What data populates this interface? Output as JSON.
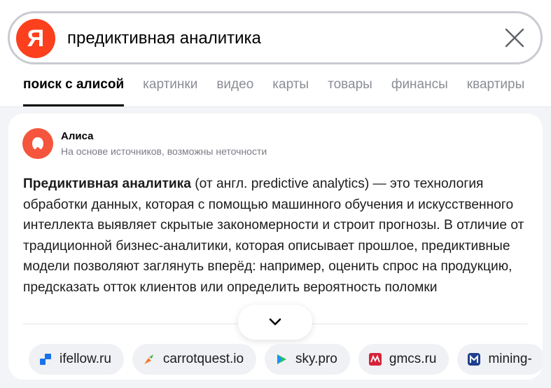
{
  "search": {
    "query": "предиктивная аналитика",
    "logo_letter": "Я"
  },
  "tabs": [
    {
      "label": "поиск с алисой",
      "active": true
    },
    {
      "label": "картинки"
    },
    {
      "label": "видео"
    },
    {
      "label": "карты"
    },
    {
      "label": "товары"
    },
    {
      "label": "финансы"
    },
    {
      "label": "квартиры"
    }
  ],
  "alice": {
    "name": "Алиса",
    "subtitle": "На основе источников, возможны неточности",
    "answer_bold": "Предиктивная аналитика",
    "answer_text": " (от англ. predictive analytics) — это технология обработки данных, которая с помощью машинного обучения и искусственного интеллекта выявляет скрытые закономерности и строит прогнозы. В отличие от традиционной бизнес-аналитики, которая описывает прошлое, предиктивные модели позволяют заглянуть вперёд: например, оценить спрос на продукцию, предсказать отток клиентов или определить вероятность поломки"
  },
  "sources": [
    {
      "label": "ifellow.ru",
      "icon": "ifellow-icon",
      "color": "#1a73e8"
    },
    {
      "label": "carrotquest.io",
      "icon": "carrotquest-icon",
      "color": "#f07a2b"
    },
    {
      "label": "sky.pro",
      "icon": "skypro-icon",
      "color": "#2bbf5f"
    },
    {
      "label": "gmcs.ru",
      "icon": "gmcs-icon",
      "color": "#d6223a"
    },
    {
      "label": "mining-",
      "icon": "mining-icon",
      "color": "#1f3f8f"
    }
  ],
  "colors": {
    "yandex_red": "#fc3f1d",
    "alice_orange": "#f5553d"
  }
}
